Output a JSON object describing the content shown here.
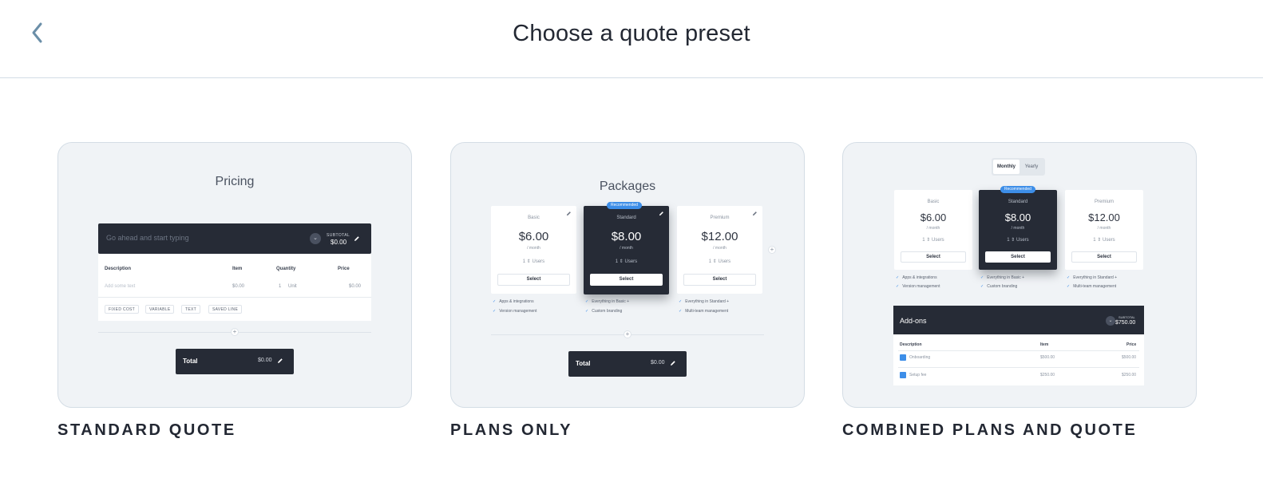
{
  "header": {
    "title": "Choose a quote preset"
  },
  "presets": [
    {
      "label": "STANDARD QUOTE",
      "preview": {
        "title": "Pricing",
        "placeholder": "Go ahead and start typing",
        "subtotal_label": "SUBTOTAL",
        "subtotal_value": "$0.00",
        "columns": [
          "Description",
          "Item",
          "Quantity",
          "Price"
        ],
        "row": {
          "description": "Add some text",
          "item": "$0.00",
          "quantity": "1",
          "unit": "Unit",
          "price": "$0.00"
        },
        "tags": [
          "FIXED COST",
          "VARIABLE",
          "TEXT",
          "SAVED LINE"
        ],
        "total_label": "Total",
        "total_value": "$0.00"
      }
    },
    {
      "label": "PLANS ONLY",
      "preview": {
        "title": "Packages",
        "recommended": "Recommended",
        "plans": [
          {
            "name": "Basic",
            "price": "$6.00",
            "per": "/ month",
            "users_qty": "1",
            "users": "Users",
            "select": "Select"
          },
          {
            "name": "Standard",
            "price": "$8.00",
            "per": "/ month",
            "users_qty": "1",
            "users": "Users",
            "select": "Select"
          },
          {
            "name": "Premium",
            "price": "$12.00",
            "per": "/ month",
            "users_qty": "1",
            "users": "Users",
            "select": "Select"
          }
        ],
        "features": [
          [
            "Apps & integrations",
            "Version management"
          ],
          [
            "Everything in Basic +",
            "Custom branding"
          ],
          [
            "Everything in Standard +",
            "Multi-team management"
          ]
        ],
        "total_label": "Total",
        "total_value": "$0.00"
      }
    },
    {
      "label": "COMBINED PLANS AND QUOTE",
      "preview": {
        "toggle": [
          "Monthly",
          "Yearly"
        ],
        "recommended": "Recommended",
        "plans": [
          {
            "name": "Basic",
            "price": "$6.00",
            "per": "/ month",
            "users_qty": "1",
            "users": "Users",
            "select": "Select"
          },
          {
            "name": "Standard",
            "price": "$8.00",
            "per": "/ month",
            "users_qty": "1",
            "users": "Users",
            "select": "Select"
          },
          {
            "name": "Premium",
            "price": "$12.00",
            "per": "/ month",
            "users_qty": "1",
            "users": "Users",
            "select": "Select"
          }
        ],
        "features": [
          [
            "Apps & integrations",
            "Version management"
          ],
          [
            "Everything in Basic +",
            "Custom branding"
          ],
          [
            "Everything in Standard +",
            "Multi-team management"
          ]
        ],
        "addons_title": "Add-ons",
        "addons_subtotal_label": "SUBTOTAL",
        "addons_subtotal": "$750.00",
        "addons_columns": [
          "Description",
          "Item",
          "Price"
        ],
        "addons": [
          {
            "description": "Onboarding",
            "item": "$500.00",
            "price": "$500.00"
          },
          {
            "description": "Setup fee",
            "item": "$250.00",
            "price": "$250.00"
          }
        ]
      }
    }
  ]
}
